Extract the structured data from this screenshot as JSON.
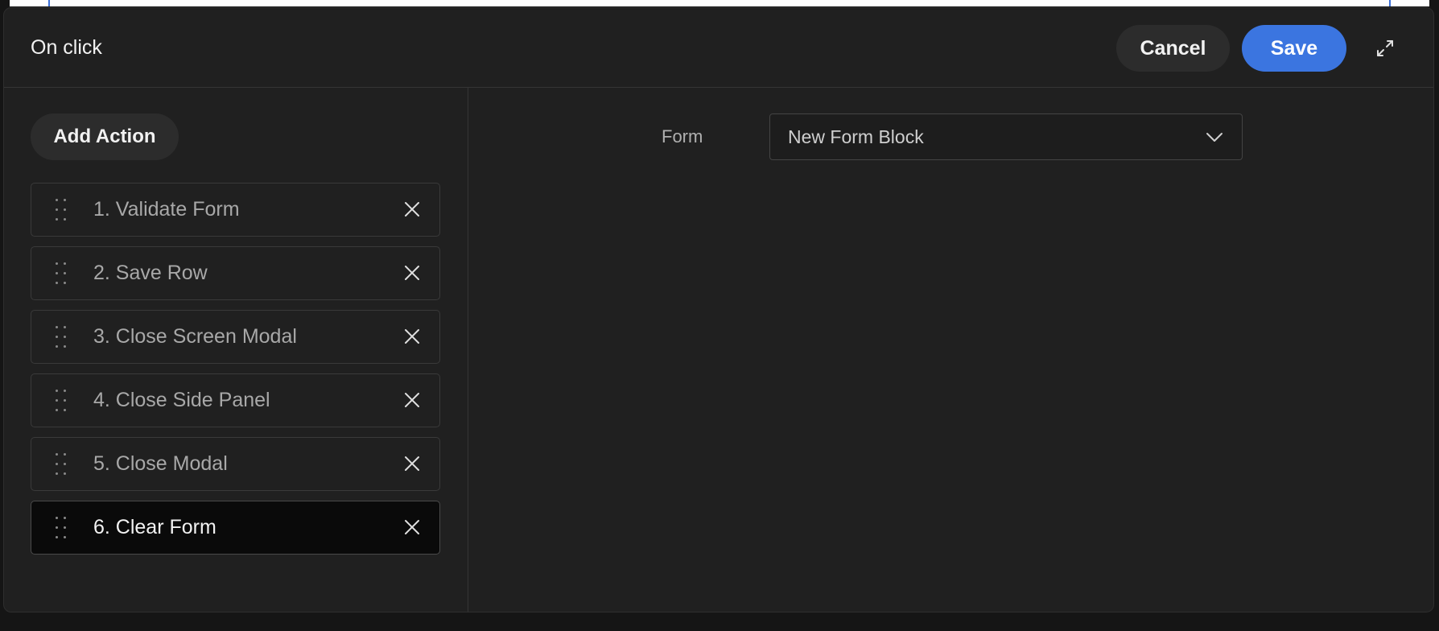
{
  "colors": {
    "accent": "#3b75e0",
    "background": "#202020",
    "selected_item_bg": "#0a0a0a"
  },
  "header": {
    "title": "On click",
    "cancel_label": "Cancel",
    "save_label": "Save",
    "expand_icon": "expand-icon"
  },
  "left_panel": {
    "add_action_label": "Add Action",
    "actions": [
      {
        "label": "1. Validate Form",
        "selected": false
      },
      {
        "label": "2. Save Row",
        "selected": false
      },
      {
        "label": "3. Close Screen Modal",
        "selected": false
      },
      {
        "label": "4. Close Side Panel",
        "selected": false
      },
      {
        "label": "5. Close Modal",
        "selected": false
      },
      {
        "label": "6. Clear Form",
        "selected": true
      }
    ]
  },
  "right_panel": {
    "form_label": "Form",
    "form_select_value": "New Form Block"
  }
}
